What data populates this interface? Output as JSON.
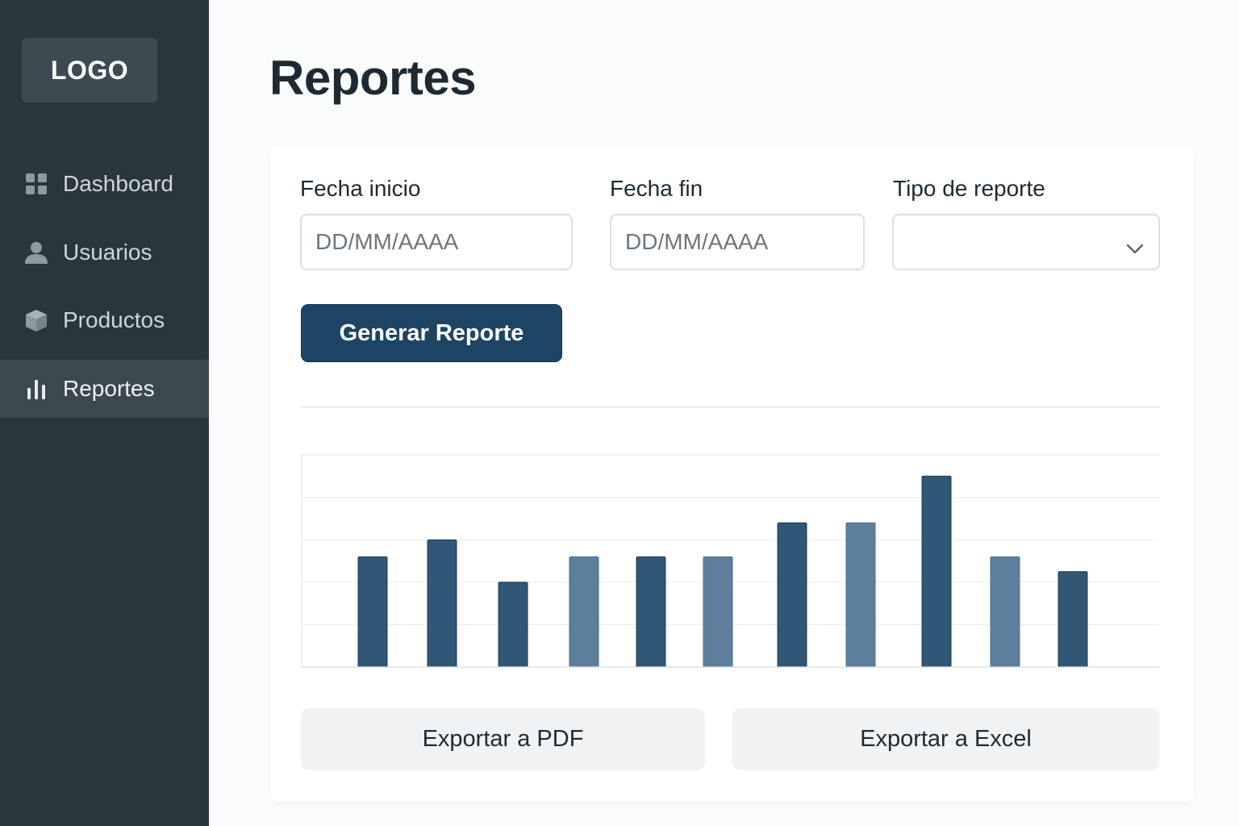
{
  "sidebar": {
    "logo": "LOGO",
    "items": [
      {
        "label": "Dashboard",
        "icon": "grid-icon"
      },
      {
        "label": "Usuarios",
        "icon": "user-icon"
      },
      {
        "label": "Productos",
        "icon": "box-icon"
      },
      {
        "label": "Reportes",
        "icon": "bar-chart-icon",
        "active": true
      }
    ]
  },
  "main": {
    "title": "Reportes",
    "filters": {
      "start_date": {
        "label": "Fecha inicio",
        "placeholder": "DD/MM/AAAA",
        "value": ""
      },
      "end_date": {
        "label": "Fecha fin",
        "placeholder": "DD/MM/AAAA",
        "value": ""
      },
      "report_type": {
        "label": "Tipo de reporte",
        "value": ""
      }
    },
    "generate_label": "Generar Reporte",
    "export_pdf_label": "Exportar a PDF",
    "export_excel_label": "Exportar a Excel"
  },
  "colors": {
    "sidebar_bg": "#2a363d",
    "primary": "#1d4563",
    "bar_dark": "#305775",
    "bar_light": "#5d7f9b"
  },
  "chart_data": {
    "type": "bar",
    "categories": [
      "",
      "",
      "",
      "",
      "",
      "",
      "",
      "",
      "",
      "",
      ""
    ],
    "values": [
      2.6,
      3.0,
      2.0,
      2.6,
      2.6,
      2.6,
      3.4,
      3.4,
      4.5,
      2.6,
      2.25
    ],
    "shade": [
      "dark",
      "dark",
      "dark",
      "light",
      "dark",
      "light",
      "dark",
      "light",
      "dark",
      "light",
      "dark"
    ],
    "title": "",
    "xlabel": "",
    "ylabel": "",
    "ylim": [
      0,
      5
    ],
    "grid": true
  }
}
